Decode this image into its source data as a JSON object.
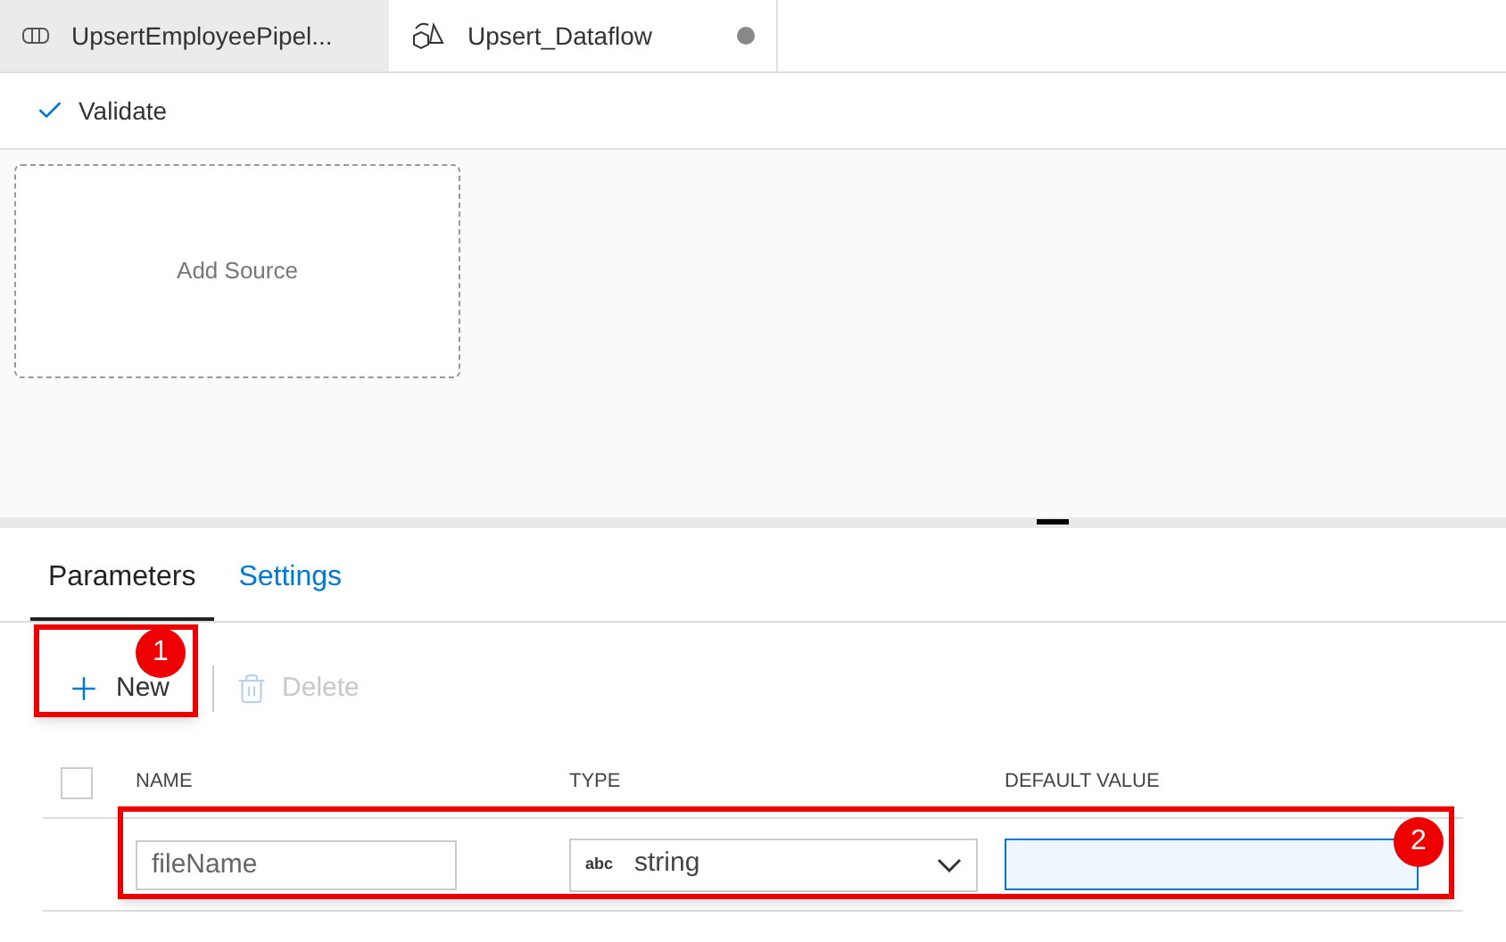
{
  "editor_tabs": [
    {
      "kind": "pipeline",
      "label": "UpsertEmployeePipel...",
      "selected": false,
      "modified": false
    },
    {
      "kind": "dataflow",
      "label": "Upsert_Dataflow",
      "selected": true,
      "modified": true
    }
  ],
  "toolbar": {
    "validate": "Validate"
  },
  "canvas": {
    "add_source": "Add Source"
  },
  "panel_tabs": [
    {
      "label": "Parameters",
      "selected": true
    },
    {
      "label": "Settings",
      "selected": false
    }
  ],
  "actions": {
    "new": {
      "label": "New",
      "disabled": false
    },
    "delete": {
      "label": "Delete",
      "disabled": true
    }
  },
  "table": {
    "select_all_checked": false,
    "columns": [
      "NAME",
      "TYPE",
      "DEFAULT VALUE"
    ],
    "rows": [
      {
        "name": "fileName",
        "type_badge": "abc",
        "type": "string",
        "default_value": ""
      }
    ]
  },
  "callouts": [
    "1",
    "2"
  ]
}
